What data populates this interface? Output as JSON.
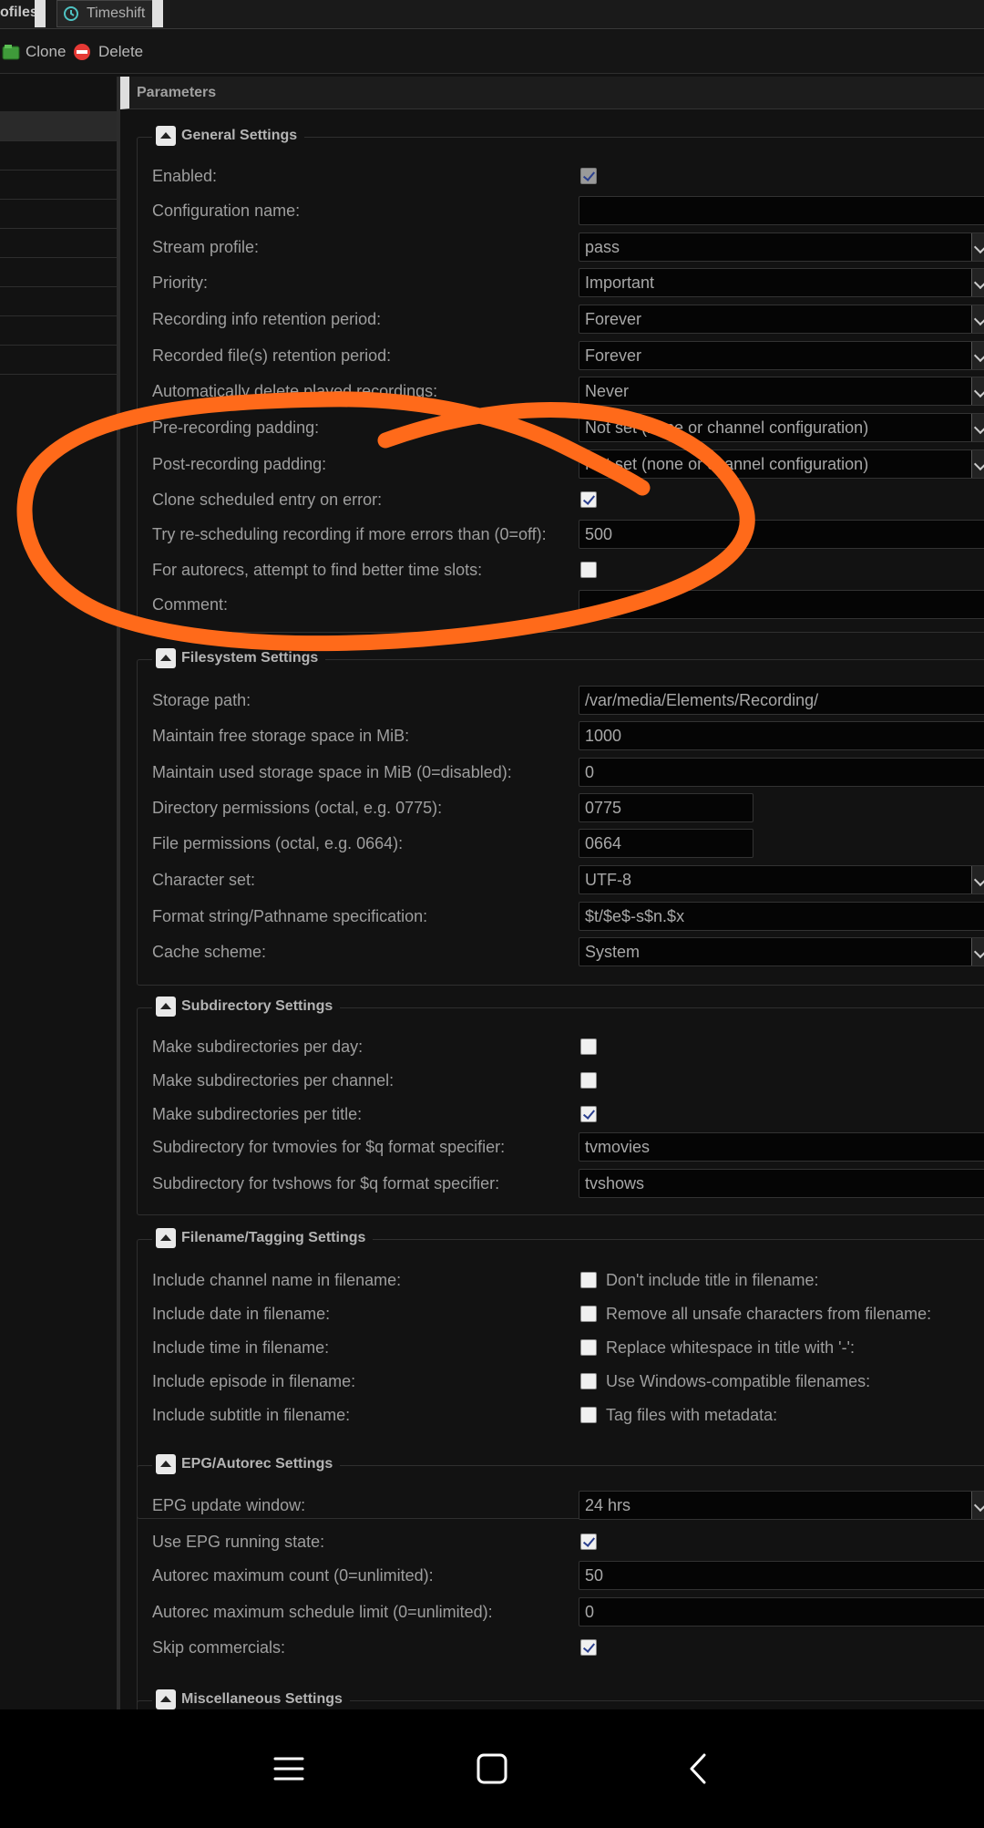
{
  "tabs": {
    "profiles": "ofiles",
    "timeshift": "Timeshift"
  },
  "toolbar": {
    "clone": "Clone",
    "delete": "Delete"
  },
  "panel": {
    "title": "Parameters"
  },
  "general": {
    "legend": "General Settings",
    "enabled": "Enabled:",
    "config_name": "Configuration name:",
    "config_name_value": "",
    "stream_profile": "Stream profile:",
    "stream_profile_value": "pass",
    "priority": "Priority:",
    "priority_value": "Important",
    "rec_info_retention": "Recording info retention period:",
    "rec_info_retention_value": "Forever",
    "rec_file_retention": "Recorded file(s) retention period:",
    "rec_file_retention_value": "Forever",
    "auto_delete": "Automatically delete played recordings:",
    "auto_delete_value": "Never",
    "pre_padding": "Pre-recording padding:",
    "pre_padding_value": "Not set (none or channel configuration)",
    "post_padding": "Post-recording padding:",
    "post_padding_value": "Not set (none or channel configuration)",
    "clone_on_error": "Clone scheduled entry on error:",
    "reschedule": "Try re-scheduling recording if more errors than (0=off):",
    "reschedule_value": "500",
    "autorec_better": "For autorecs, attempt to find better time slots:",
    "comment": "Comment:",
    "comment_value": ""
  },
  "filesystem": {
    "legend": "Filesystem Settings",
    "storage_path": "Storage path:",
    "storage_path_value": "/var/media/Elements/Recording/",
    "free_space": "Maintain free storage space in MiB:",
    "free_space_value": "1000",
    "used_space": "Maintain used storage space in MiB (0=disabled):",
    "used_space_value": "0",
    "dir_perm": "Directory permissions (octal, e.g. 0775):",
    "dir_perm_value": "0775",
    "file_perm": "File permissions (octal, e.g. 0664):",
    "file_perm_value": "0664",
    "charset": "Character set:",
    "charset_value": "UTF-8",
    "format": "Format string/Pathname specification:",
    "format_value": "$t/$e$-s$n.$x",
    "cache": "Cache scheme:",
    "cache_value": "System"
  },
  "subdir": {
    "legend": "Subdirectory Settings",
    "per_day": "Make subdirectories per day:",
    "per_channel": "Make subdirectories per channel:",
    "per_title": "Make subdirectories per title:",
    "tvmovies": "Subdirectory for tvmovies for $q format specifier:",
    "tvmovies_value": "tvmovies",
    "tvshows": "Subdirectory for tvshows for $q format specifier:",
    "tvshows_value": "tvshows"
  },
  "filename": {
    "legend": "Filename/Tagging Settings",
    "rows": [
      {
        "left": "Include channel name in filename:",
        "right": "Don't include title in filename:"
      },
      {
        "left": "Include date in filename:",
        "right": "Remove all unsafe characters from filename:"
      },
      {
        "left": "Include time in filename:",
        "right": "Replace whitespace in title with '-':"
      },
      {
        "left": "Include episode in filename:",
        "right": "Use Windows-compatible filenames:"
      },
      {
        "left": "Include subtitle in filename:",
        "right": "Tag files with metadata:"
      }
    ]
  },
  "epg": {
    "legend": "EPG/Autorec Settings",
    "window": "EPG update window:",
    "window_value": "24 hrs",
    "running": "Use EPG running state:",
    "max_count": "Autorec maximum count (0=unlimited):",
    "max_count_value": "50",
    "max_sched": "Autorec maximum schedule limit (0=unlimited):",
    "max_sched_value": "0",
    "skip_comm": "Skip commercials:"
  },
  "misc": {
    "legend": "Miscellaneous Settings"
  },
  "annotation_color": "#ff6a1a",
  "icons": [
    "timeshift-icon",
    "clone-icon",
    "delete-icon",
    "menu-icon",
    "home-icon",
    "back-icon"
  ]
}
